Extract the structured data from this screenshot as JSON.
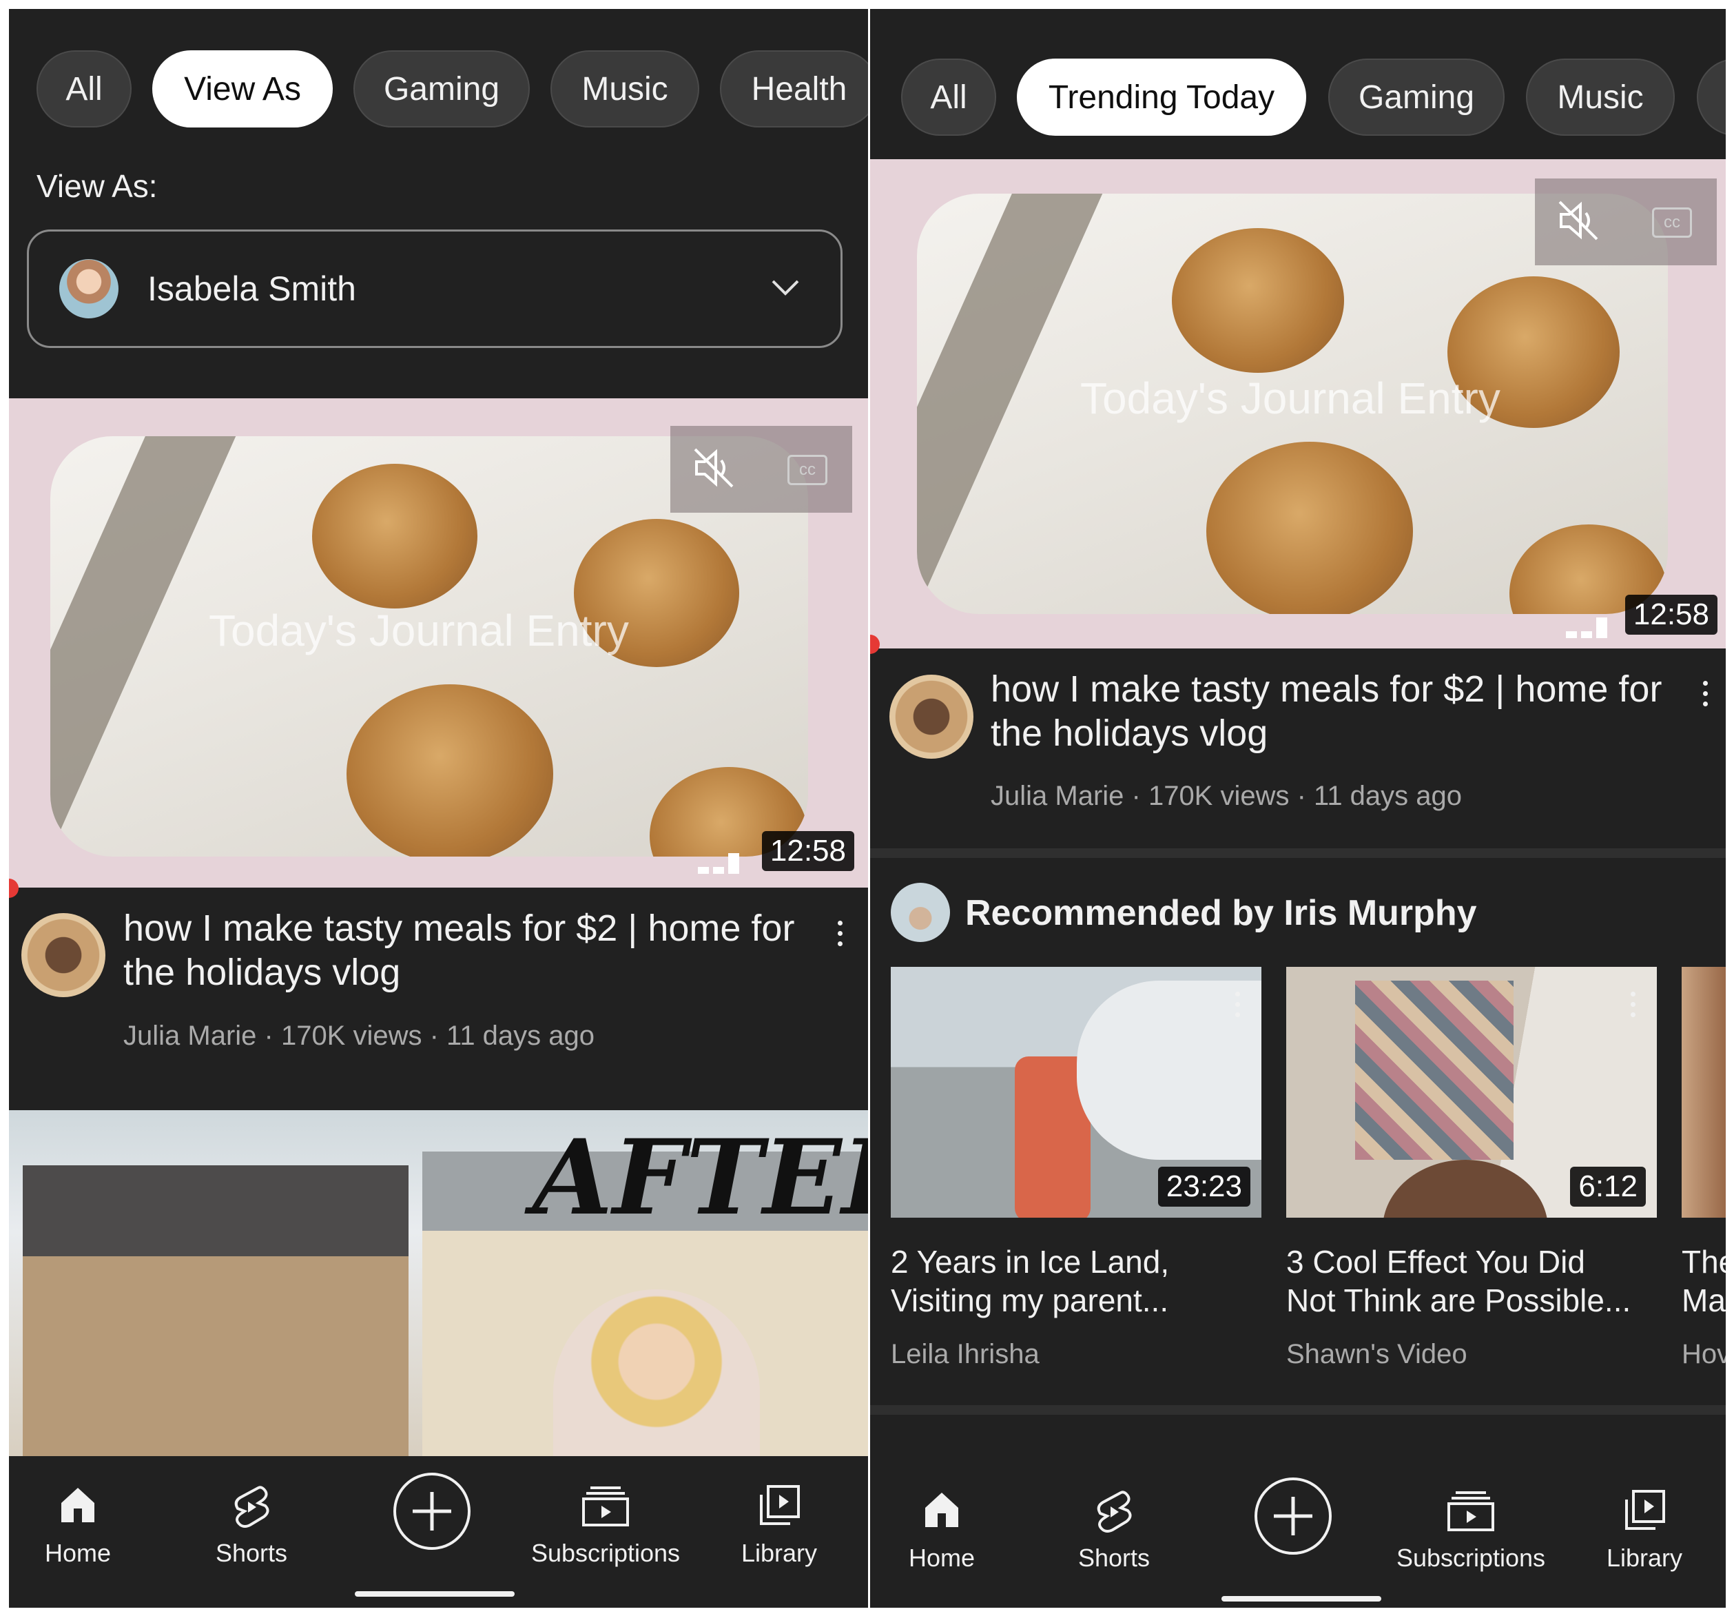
{
  "colors": {
    "background": "#212121",
    "accent_pink": "#e6d3d9",
    "chip_active": "#ffffff",
    "chip_inactive": "#3a3a3a",
    "text_secondary": "#aaaaaa",
    "progress_red": "#e53935"
  },
  "left": {
    "chips": [
      {
        "label": "All",
        "active": false
      },
      {
        "label": "View As",
        "active": true
      },
      {
        "label": "Gaming",
        "active": false
      },
      {
        "label": "Music",
        "active": false
      },
      {
        "label": "Health",
        "active": false
      }
    ],
    "view_as": {
      "label": "View As:",
      "selected_user": "Isabela Smith",
      "icon": "chevron-down-icon"
    },
    "featured": {
      "overlay_text": "Today's Journal Entry",
      "duration": "12:58",
      "title": "how I make tasty meals for $2 | home for the holidays vlog",
      "meta": "Julia Marie · 170K views · 11 days ago"
    },
    "next_thumb": {
      "overlay_text": "AFTER"
    }
  },
  "right": {
    "chips": [
      {
        "label": "All",
        "active": false
      },
      {
        "label": "Trending Today",
        "active": true
      },
      {
        "label": "Gaming",
        "active": false
      },
      {
        "label": "Music",
        "active": false
      }
    ],
    "featured": {
      "overlay_text": "Today's Journal Entry",
      "duration": "12:58",
      "title": "how I make tasty meals for $2 | home for the holidays vlog",
      "meta": "Julia Marie · 170K views · 11 days ago"
    },
    "recommended": {
      "heading": "Recommended by Iris Murphy",
      "videos": [
        {
          "duration": "23:23",
          "title_line1": "2 Years in Ice Land,",
          "title_line2": "Visiting my parent...",
          "channel": "Leila Ihrisha"
        },
        {
          "duration": "6:12",
          "title_line1": "3 Cool Effect You Did",
          "title_line2": "Not Think are Possible...",
          "channel": "Shawn's Video"
        },
        {
          "title_line1": "The",
          "title_line2": "Ma",
          "channel": "Hov"
        }
      ]
    }
  },
  "nav": {
    "items": [
      {
        "label": "Home",
        "icon": "home-icon"
      },
      {
        "label": "Shorts",
        "icon": "shorts-icon"
      },
      {
        "label": "",
        "icon": "create-icon"
      },
      {
        "label": "Subscriptions",
        "icon": "subscriptions-icon"
      },
      {
        "label": "Library",
        "icon": "library-icon"
      }
    ]
  }
}
